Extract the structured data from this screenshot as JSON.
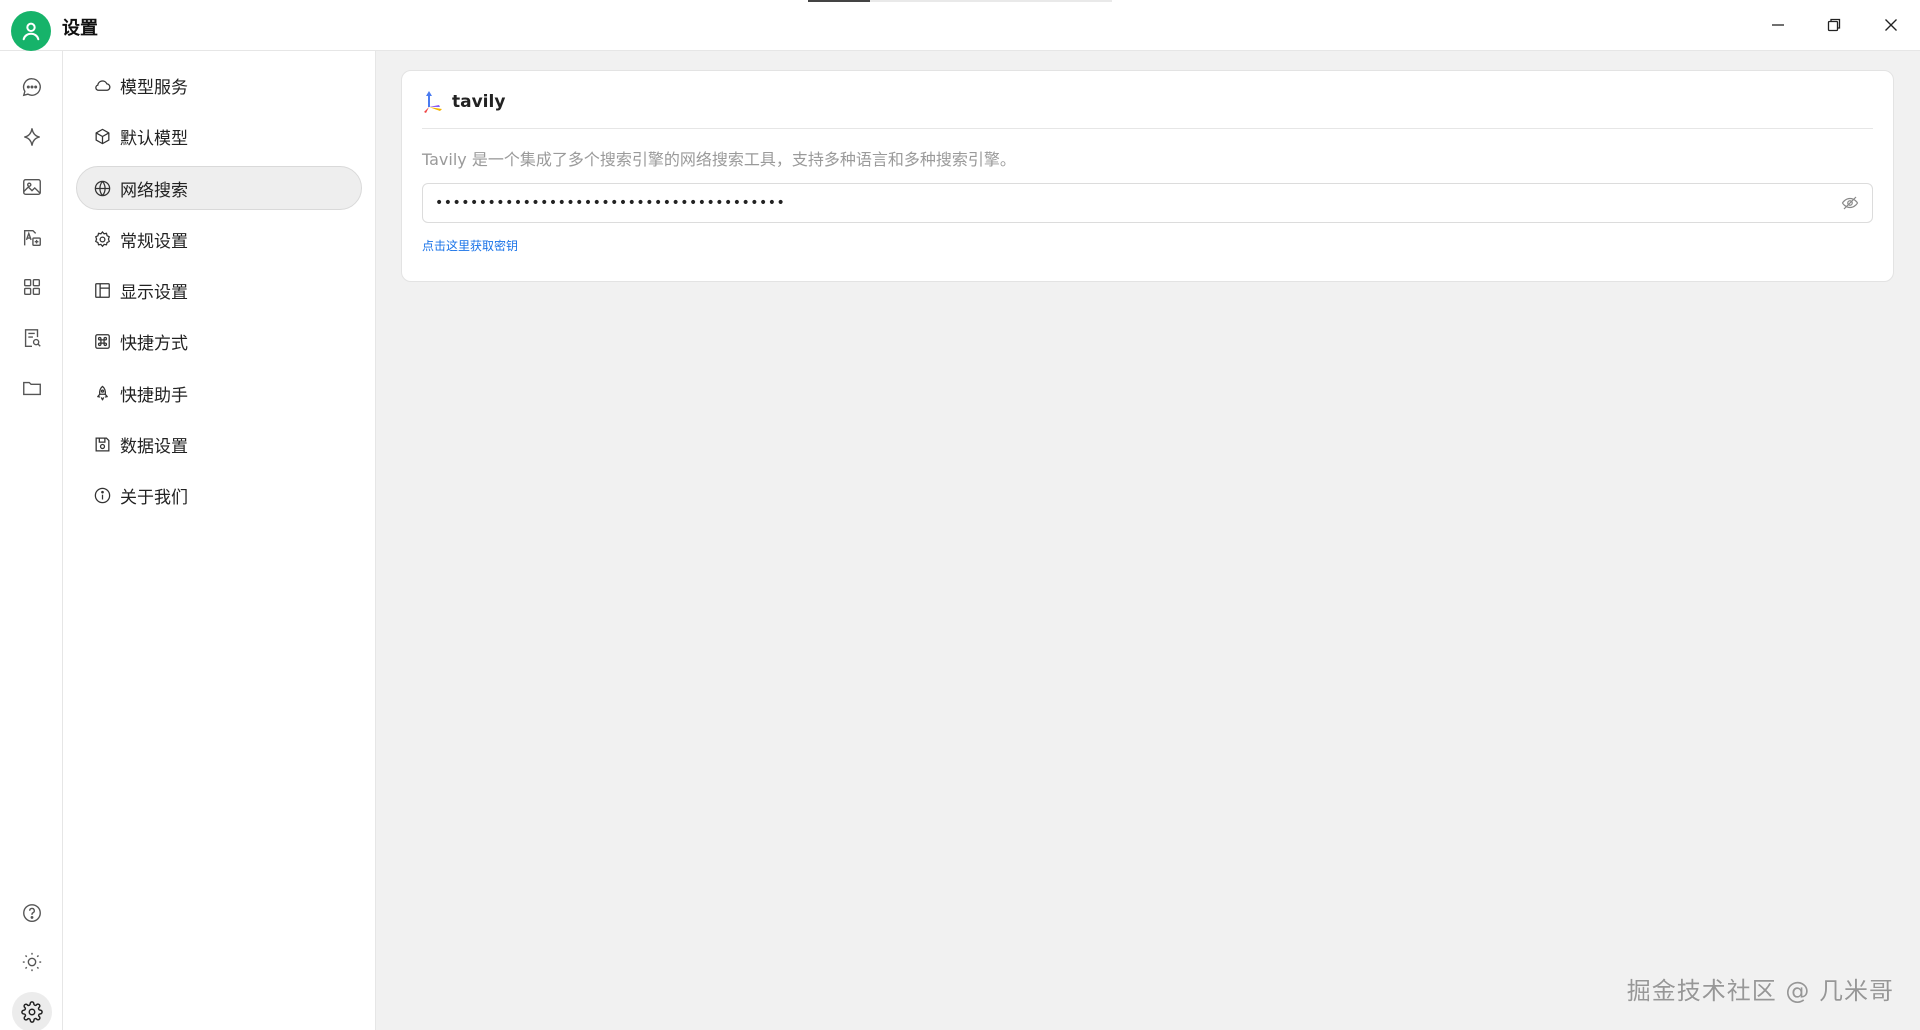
{
  "window": {
    "title": "设置",
    "controls": [
      "minimize-icon",
      "restore-icon",
      "close-icon"
    ]
  },
  "rail": {
    "top_items": [
      "chat-icon",
      "sparkle-icon",
      "image-icon",
      "translate-icon",
      "apps-icon",
      "document-search-icon",
      "folder-icon"
    ],
    "bottom_items": [
      "help-icon",
      "theme-sun-icon",
      "settings-icon"
    ],
    "active": "settings-icon"
  },
  "settings_menu": {
    "items": [
      {
        "label": "模型服务",
        "icon": "cloud-icon"
      },
      {
        "label": "默认模型",
        "icon": "cube-icon"
      },
      {
        "label": "网络搜索",
        "icon": "globe-icon"
      },
      {
        "label": "常规设置",
        "icon": "gear-icon"
      },
      {
        "label": "显示设置",
        "icon": "layout-icon"
      },
      {
        "label": "快捷方式",
        "icon": "command-icon"
      },
      {
        "label": "快捷助手",
        "icon": "rocket-icon"
      },
      {
        "label": "数据设置",
        "icon": "save-icon"
      },
      {
        "label": "关于我们",
        "icon": "info-icon"
      }
    ],
    "active_index": 2
  },
  "web_search": {
    "provider": {
      "name": "tavily",
      "description": "Tavily 是一个集成了多个搜索引擎的网络搜索工具，支持多种语言和多种搜索引擎。",
      "api_key_masked": "••••••••••••••••••••••••••••••••••••••••",
      "get_key_link": "点击这里获取密钥"
    }
  },
  "watermark": "掘金技术社区 @ 几米哥",
  "colors": {
    "accent": "#1a73e8",
    "avatar_green": "#16b36a",
    "main_bg": "#f1f1f1"
  }
}
